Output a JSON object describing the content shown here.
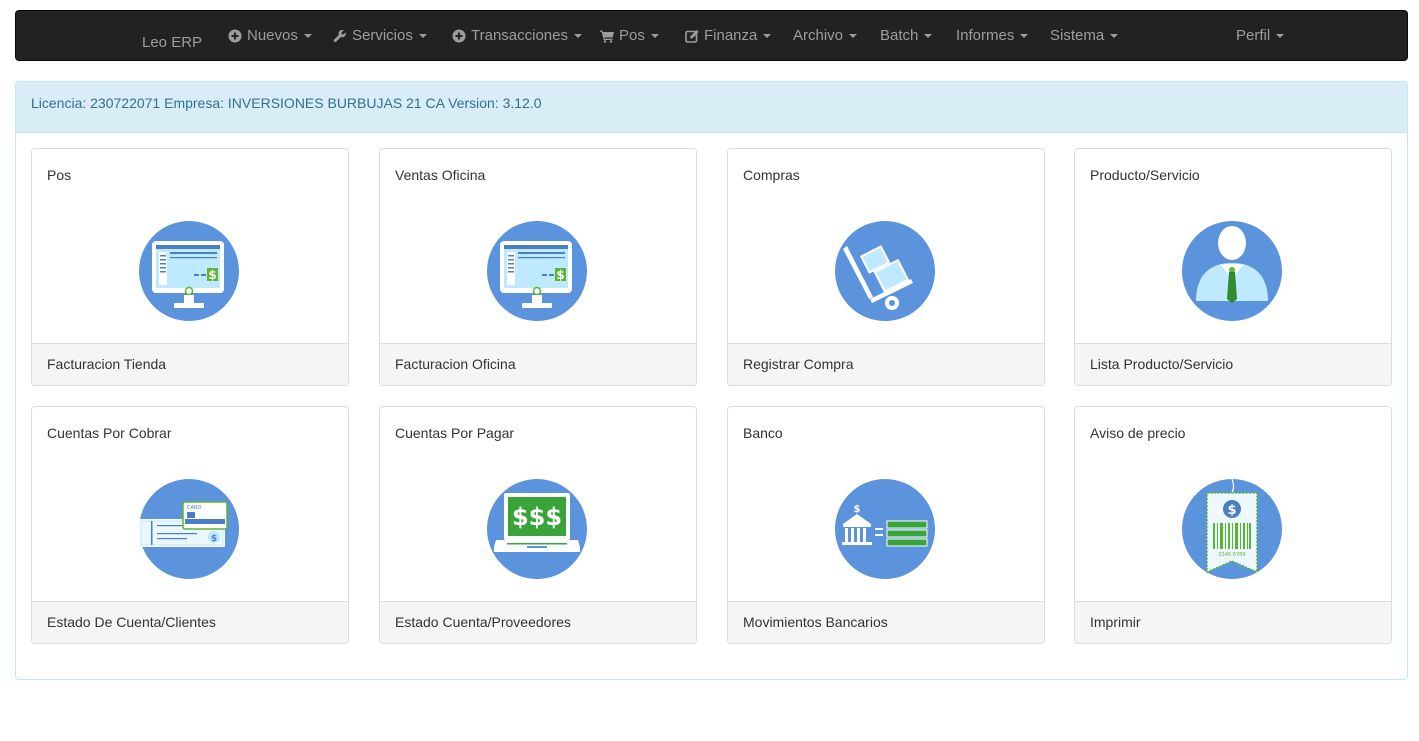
{
  "navbar": {
    "brand": "Leo ERP",
    "items": [
      {
        "label": "Nuevos",
        "icon": "plus-circle-icon"
      },
      {
        "label": "Servicios",
        "icon": "wrench-icon"
      },
      {
        "label": "Transacciones",
        "icon": "plus-circle-icon"
      },
      {
        "label": "Pos",
        "icon": "shopping-cart-icon"
      },
      {
        "label": "Finanza",
        "icon": "edit-icon"
      },
      {
        "label": "Archivo",
        "icon": ""
      },
      {
        "label": "Batch",
        "icon": ""
      },
      {
        "label": "Informes",
        "icon": ""
      },
      {
        "label": "Sistema",
        "icon": ""
      }
    ],
    "profile": "Perfil"
  },
  "panel": {
    "heading": "Licencia: 230722071 Empresa: INVERSIONES BURBUJAS 21 CA Version: 3.12.0"
  },
  "cards": [
    {
      "title": "Pos",
      "footer": "Facturacion Tienda",
      "icon": "pos-monitor-icon"
    },
    {
      "title": "Ventas Oficina",
      "footer": "Facturacion Oficina",
      "icon": "pos-monitor-icon"
    },
    {
      "title": "Compras",
      "footer": "Registrar Compra",
      "icon": "hand-truck-icon"
    },
    {
      "title": "Producto/Servicio",
      "footer": "Lista Producto/Servicio",
      "icon": "person-icon"
    },
    {
      "title": "Cuentas Por Cobrar",
      "footer": "Estado De Cuenta/Clientes",
      "icon": "card-check-icon"
    },
    {
      "title": "Cuentas Por Pagar",
      "footer": "Estado Cuenta/Proveedores",
      "icon": "laptop-money-icon"
    },
    {
      "title": "Banco",
      "footer": "Movimientos Bancarios",
      "icon": "bank-equals-icon"
    },
    {
      "title": "Aviso de precio",
      "footer": "Imprimir",
      "icon": "price-tag-icon"
    }
  ],
  "colors": {
    "navbar_bg": "#222222",
    "nav_text": "#9d9d9d",
    "info_bg": "#d9edf7",
    "info_text": "#31708f",
    "icon_circle": "#5b93dc",
    "accent_green": "#5cb531"
  }
}
